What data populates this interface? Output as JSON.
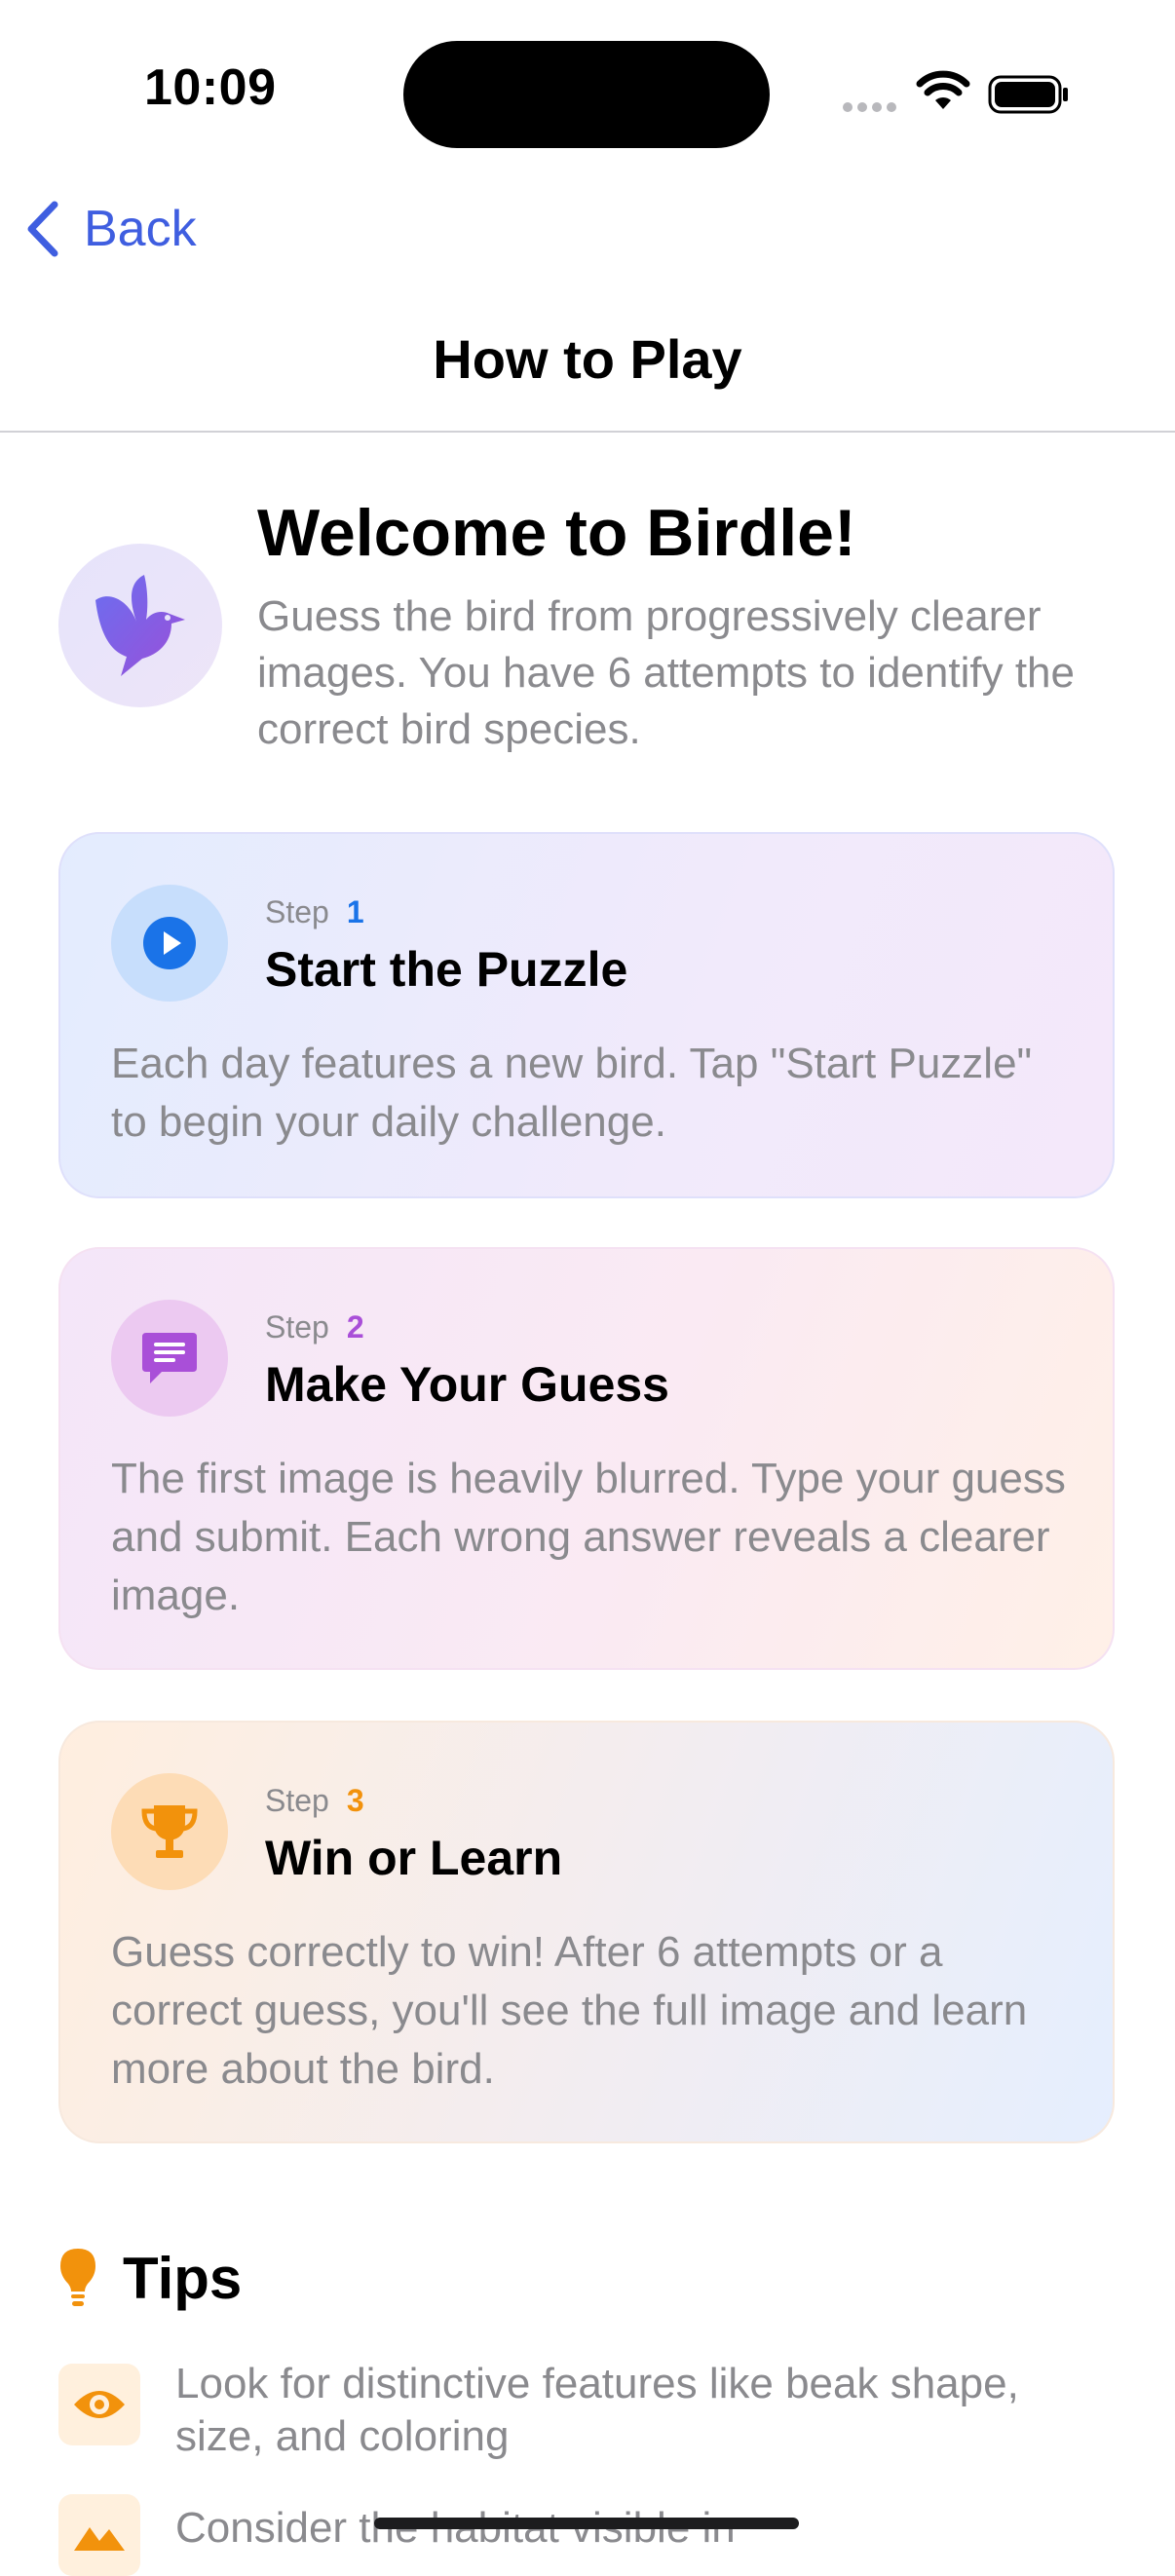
{
  "status_bar": {
    "time": "10:09"
  },
  "nav": {
    "back_label": "Back",
    "title": "How to Play"
  },
  "welcome": {
    "title": "Welcome to Birdle!",
    "description": "Guess the bird from progressively clearer images. You have 6 attempts to identify the correct bird species."
  },
  "steps": [
    {
      "step_word": "Step",
      "number": "1",
      "title": "Start the Puzzle",
      "description": "Each day features a new bird. Tap \"Start Puzzle\" to begin your daily challenge.",
      "icon": "play-icon",
      "accent": "#1a73e8"
    },
    {
      "step_word": "Step",
      "number": "2",
      "title": "Make Your Guess",
      "description": "The first image is heavily blurred. Type your guess and submit. Each wrong answer reveals a clearer image.",
      "icon": "message-icon",
      "accent": "#a94fd8"
    },
    {
      "step_word": "Step",
      "number": "3",
      "title": "Win or Learn",
      "description": "Guess correctly to win! After 6 attempts or a correct guess, you'll see the full image and learn more about the bird.",
      "icon": "trophy-icon",
      "accent": "#f2920c"
    }
  ],
  "tips": {
    "title": "Tips",
    "items": [
      {
        "text": "Look for distinctive features like beak shape, size, and coloring",
        "icon": "eye-icon"
      },
      {
        "text": "Consider the habitat visible in",
        "icon": "landscape-icon"
      }
    ]
  }
}
